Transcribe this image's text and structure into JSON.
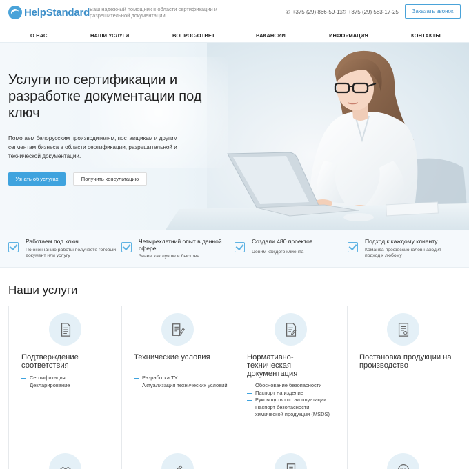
{
  "header": {
    "logo_text": "HelpStandard",
    "tagline": "Ваш надежный помощник в области сертификации и разрешительной документации",
    "phone1": "+375 (29) 866-59-11",
    "phone2": "+375 (29) 583-17-25",
    "call_button": "Заказать звонок"
  },
  "nav": {
    "items": [
      "О НАС",
      "НАШИ УСЛУГИ",
      "ВОПРОС-ОТВЕТ",
      "ВАКАНСИИ",
      "ИНФОРМАЦИЯ",
      "КОНТАКТЫ"
    ]
  },
  "hero": {
    "title": "Услуги по сертификации и разработке документации под ключ",
    "description": "Помогаем белорусским производителям, поставщикам и другим сегментам бизнеса в области сертификации, разрешительной и технической документации.",
    "primary_button": "Узнать об услугах",
    "secondary_button": "Получить консультацию"
  },
  "features": [
    {
      "title": "Работаем под ключ",
      "subtitle": "По окончанию работы получаете готовый документ или услугу"
    },
    {
      "title": "Четырехлетний опыт в данной сфере",
      "subtitle": "Знаем как лучше и быстрее"
    },
    {
      "title": "Создали 480 проектов",
      "subtitle": "Ценим каждого клиента"
    },
    {
      "title": "Подход к каждому клиенту",
      "subtitle": "Команда профессионалов находит подход к любому"
    }
  ],
  "services": {
    "title": "Наши услуги",
    "items": [
      {
        "title": "Подтверждение соответствия",
        "list": [
          "Сертификация",
          "Декларирование"
        ]
      },
      {
        "title": "Технические условия",
        "list": [
          "Разработка ТУ",
          "Актуализация технических условий"
        ]
      },
      {
        "title": "Нормативно-техническая документация",
        "list": [
          "Обоснование безопасности",
          "Паспорт на изделие",
          "Руководство по эксплуатации",
          "Паспорт безопасности химической продукции (MSDS)"
        ]
      },
      {
        "title": "Постановка продукции на производство",
        "list": []
      }
    ]
  },
  "colors": {
    "accent": "#3fa3de",
    "logo": "#3d8fc9",
    "icon_bg": "#e4f0f7"
  }
}
